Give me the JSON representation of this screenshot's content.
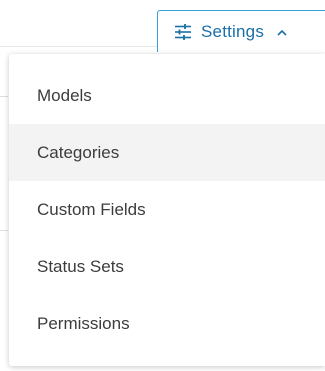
{
  "settings_button": {
    "label": "Settings",
    "icon": "sliders-icon",
    "chevron": "chevron-up-icon",
    "accent_color": "#3aa0dd",
    "text_color": "#1a6fa8"
  },
  "menu": {
    "items": [
      {
        "label": "Models",
        "highlighted": false
      },
      {
        "label": "Categories",
        "highlighted": true
      },
      {
        "label": "Custom Fields",
        "highlighted": false
      },
      {
        "label": "Status Sets",
        "highlighted": false
      },
      {
        "label": "Permissions",
        "highlighted": false
      }
    ],
    "hover_background": "#f3f3f3"
  }
}
